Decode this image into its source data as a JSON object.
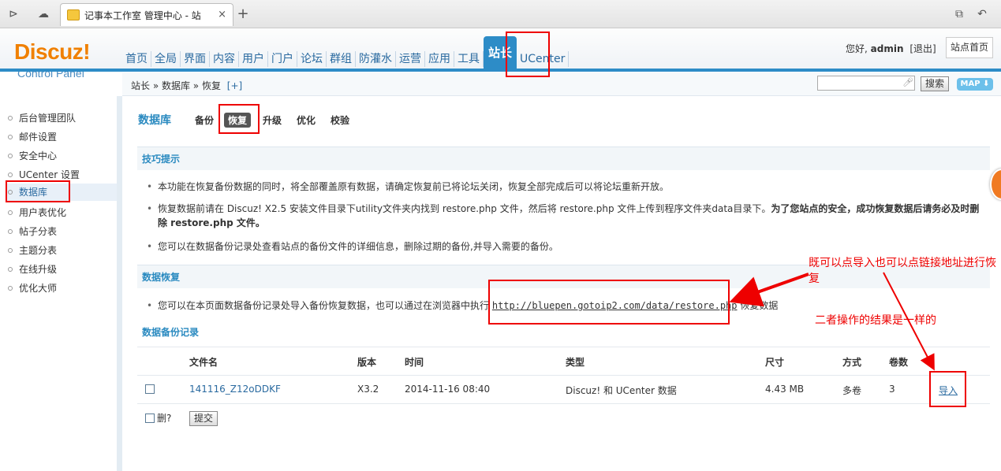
{
  "browser": {
    "tab_title": "记事本工作室 管理中心 - 站",
    "close_glyph": "×",
    "new_tab_glyph": "+"
  },
  "logo": {
    "main": "Discuz!",
    "sub": "Control Panel"
  },
  "nav": {
    "items": [
      "首页",
      "全局",
      "界面",
      "内容",
      "用户",
      "门户",
      "论坛",
      "群组",
      "防灌水",
      "运营",
      "应用",
      "工具",
      "站长",
      "UCenter"
    ],
    "active_index": 12
  },
  "user": {
    "greeting": "您好,",
    "name": "admin",
    "logout": "[退出]",
    "site_home": "站点首页"
  },
  "breadcrumb": {
    "text": "站长 » 数据库 » 恢复",
    "plus": "[+]"
  },
  "search": {
    "button": "搜索",
    "map": "MAP ⬇"
  },
  "sidebar": {
    "items": [
      "后台管理团队",
      "邮件设置",
      "安全中心",
      "UCenter 设置",
      "数据库",
      "用户表优化",
      "帖子分表",
      "主题分表",
      "在线升级",
      "优化大师"
    ],
    "active_index": 4
  },
  "main": {
    "title": "数据库",
    "tabs": [
      "备份",
      "恢复",
      "升级",
      "优化",
      "校验"
    ],
    "active_tab": 1
  },
  "tips": {
    "heading": "技巧提示",
    "items": [
      "本功能在恢复备份数据的同时，将全部覆盖原有数据，请确定恢复前已将论坛关闭，恢复全部完成后可以将论坛重新开放。",
      "恢复数据前请在 Discuz! X2.5 安装文件目录下utility文件夹内找到 restore.php 文件，然后将 restore.php 文件上传到程序文件夹data目录下。",
      "为了您站点的安全，成功恢复数据后请务必及时删除 restore.php 文件。",
      "您可以在数据备份记录处查看站点的备份文件的详细信息，删除过期的备份,并导入需要的备份。"
    ]
  },
  "restore": {
    "heading": "数据恢复",
    "text_before": "您可以在本页面数据备份记录处导入备份恢复数据，也可以通过在浏览器中执行",
    "url": "http://bluepen.gotoip2.com/data/restore.php",
    "text_after": "恢复数据"
  },
  "records": {
    "heading": "数据备份记录",
    "columns": [
      "文件名",
      "版本",
      "时间",
      "类型",
      "尺寸",
      "方式",
      "卷数"
    ],
    "rows": [
      {
        "file": "141116_Z12oDDKF",
        "version": "X3.2",
        "time": "2014-11-16 08:40",
        "type": "Discuz! 和 UCenter 数据",
        "size": "4.43 MB",
        "mode": "多卷",
        "volumes": "3",
        "action": "导入"
      }
    ],
    "delete_label": "删?",
    "submit": "提交"
  },
  "annotations": {
    "note1": "既可以点导入也可以点链接地址进行恢复",
    "note2": "二者操作的结果是一样的"
  }
}
